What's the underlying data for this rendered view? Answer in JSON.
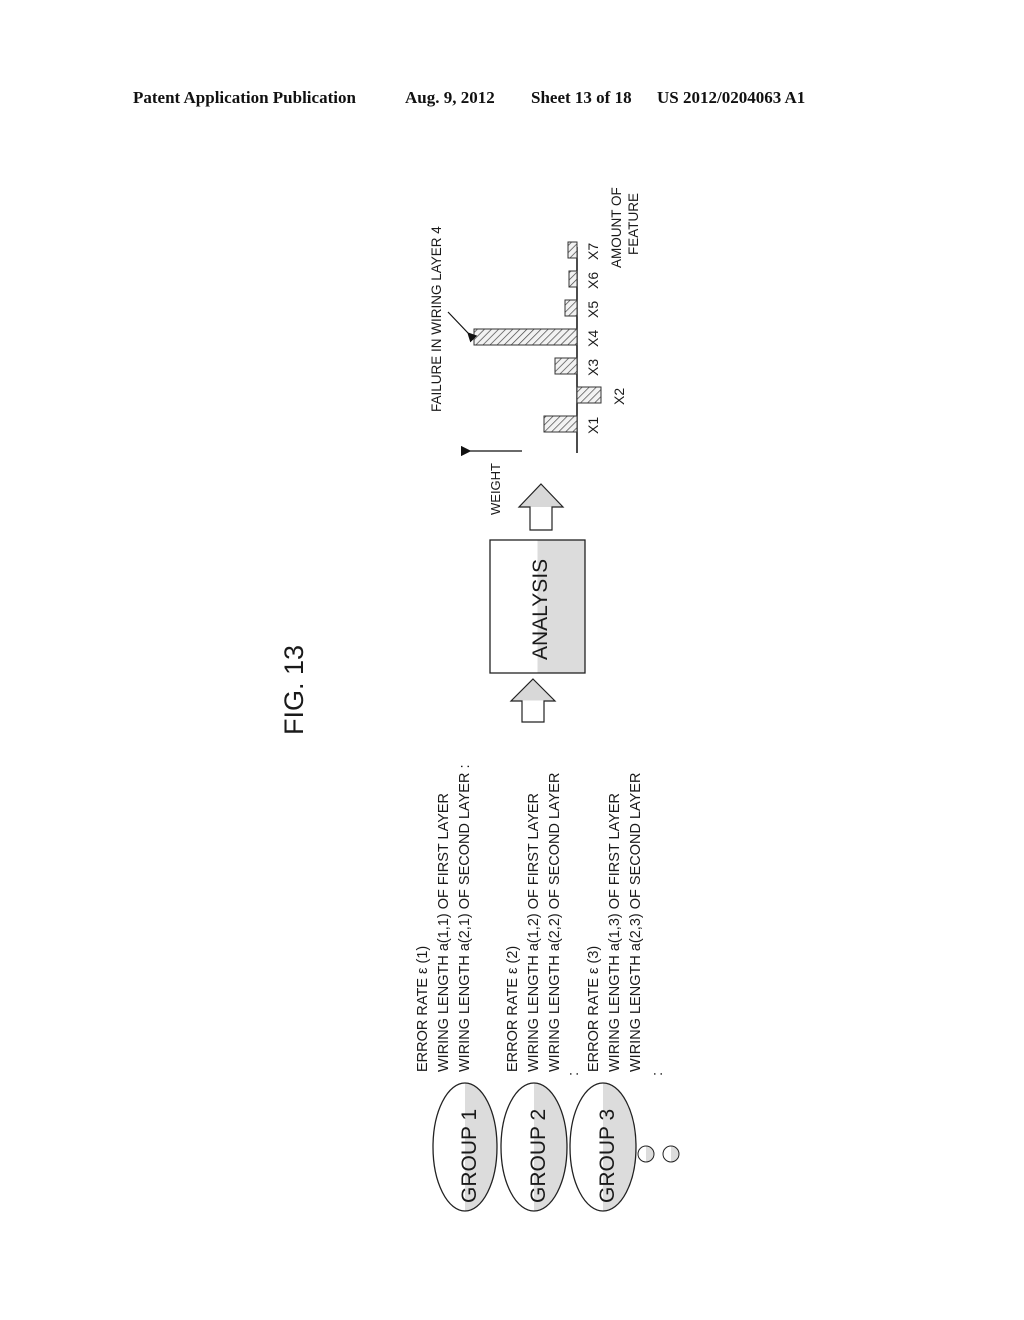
{
  "header": {
    "publication_type": "Patent Application Publication",
    "date": "Aug. 9, 2012",
    "sheet": "Sheet 13 of 18",
    "publication_number": "US 2012/0204063 A1"
  },
  "figure": {
    "title": "FIG. 13",
    "orientation": "rotated 90 degrees counter-clockwise",
    "groups": [
      {
        "label": "GROUP 1",
        "lines": [
          "ERROR RATE  ε (1)",
          "WIRING LENGTH a(1,1) OF FIRST LAYER",
          "WIRING LENGTH a(2,1) OF SECOND LAYER :"
        ]
      },
      {
        "label": "GROUP 2",
        "lines": [
          "ERROR RATE  ε (2)",
          "WIRING LENGTH a(1,2) OF FIRST LAYER",
          "WIRING LENGTH a(2,2) OF SECOND LAYER"
        ]
      },
      {
        "label": "GROUP 3",
        "lines": [
          "ERROR RATE  ε (3)",
          "WIRING LENGTH a(1,3) OF FIRST LAYER",
          "WIRING LENGTH a(2,3) OF SECOND LAYER"
        ]
      }
    ],
    "ellipsis_marks": [
      ":",
      ":",
      ":"
    ],
    "more_groups_symbol": "○○",
    "analysis_box_label": "ANALYSIS",
    "annotation": "FAILURE IN WIRING LAYER 4"
  },
  "chart_data": {
    "type": "bar",
    "orientation": "rotated 90 degrees counter-clockwise",
    "title": "",
    "xlabel": "AMOUNT OF FEATURE",
    "xlabel_lines": [
      "AMOUNT OF",
      "FEATURE"
    ],
    "ylabel": "WEIGHT",
    "categories": [
      "X1",
      "X2",
      "X3",
      "X4",
      "X5",
      "X6",
      "X7"
    ],
    "values": [
      3.3,
      -2.4,
      2.2,
      10.3,
      1.2,
      0.8,
      0.9
    ],
    "value_units": "relative weight (unlabeled axis, estimated)",
    "ylim": [
      -3,
      11
    ],
    "grid": false,
    "bar_fill": "hatched",
    "annotation": {
      "text": "FAILURE IN WIRING LAYER 4",
      "target": "X4"
    }
  }
}
